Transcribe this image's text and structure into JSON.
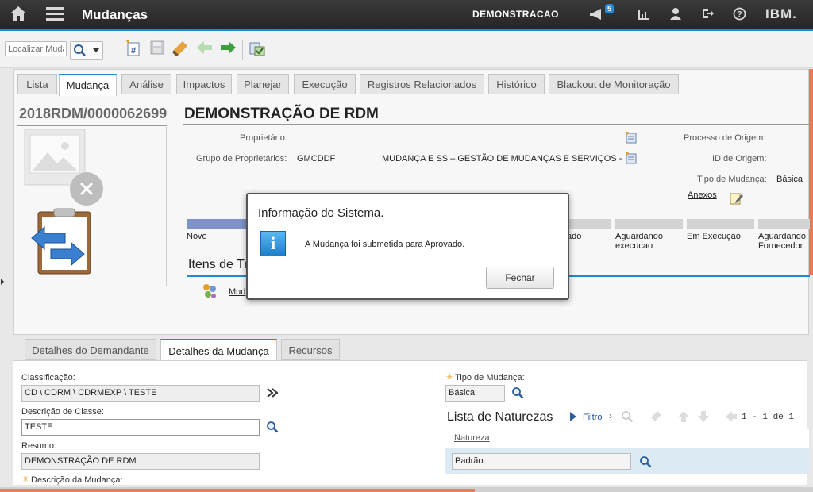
{
  "header": {
    "app_title": "Mudanças",
    "environment": "DEMONSTRACAO",
    "notification_count": "5",
    "brand": "IBM."
  },
  "toolbar": {
    "search_placeholder": "Localizar Muda"
  },
  "tabs": [
    "Lista",
    "Mudança",
    "Análise",
    "Impactos",
    "Planejar",
    "Execução",
    "Registros Relacionados",
    "Histórico",
    "Blackout de Monitoração"
  ],
  "active_tab": "Mudança",
  "record": {
    "id": "2018RDM/0000062699",
    "title": "DEMONSTRAÇÃO DE RDM",
    "owner_label": "Proprietário:",
    "owner_group_label": "Grupo de Proprietários:",
    "owner_group_value": "GMCDDF",
    "owner_group_desc": "MUDANÇA E SS – GESTÃO DE MUDANÇAS E SERVIÇOS -",
    "origin_process_label": "Processo de Origem:",
    "origin_id_label": "ID de Origem:",
    "change_type_label": "Tipo de Mudança:",
    "change_type_value": "Básica",
    "attachments_label": "Anexos"
  },
  "stages": [
    "Novo",
    "ado",
    "Aguardando execucao",
    "Em Execução",
    "Aguardando Fornecedor"
  ],
  "work_items": {
    "heading": "Itens de Tr",
    "link": "Mud"
  },
  "bottom_tabs": [
    "Detalhes do Demandante",
    "Detalhes da Mudança",
    "Recursos"
  ],
  "details": {
    "classification_label": "Classificação:",
    "classification_value": "CD \\ CDRM \\ CDRMEXP \\ TESTE",
    "class_desc_label": "Descrição de Classe:",
    "class_desc_value": "TESTE",
    "summary_label": "Resumo:",
    "summary_value": "DEMONSTRAÇÃO DE RDM",
    "change_desc_label": "Descrição da Mudança:",
    "change_type_label": "Tipo de Mudança:",
    "change_type_value": "Básica"
  },
  "natures": {
    "heading": "Lista de Naturezas",
    "filter_label": "Filtro",
    "pagination": "1 - 1 de 1",
    "column": "Natureza",
    "row_value": "Padrão"
  },
  "dialog": {
    "title": "Informação do Sistema.",
    "message": "A Mudança foi submetida para Aprovado.",
    "button": "Fechar"
  },
  "colors": {
    "accent": "#1f8ad0",
    "topbar": "#2e2e2e",
    "stage_active": "#7f93c9"
  }
}
